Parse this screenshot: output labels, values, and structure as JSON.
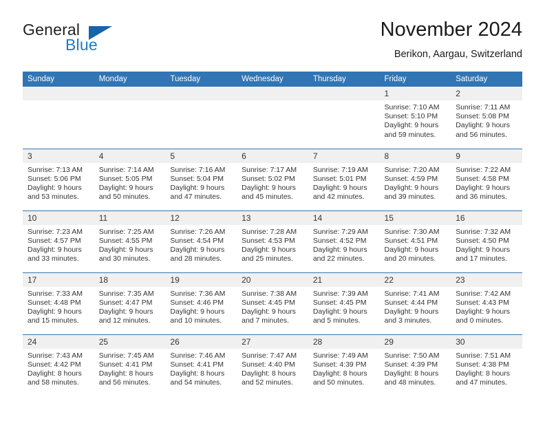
{
  "brand": {
    "name_part1": "General",
    "name_part2": "Blue",
    "flag_icon": "triangle-flag-icon"
  },
  "header": {
    "title": "November 2024",
    "subtitle": "Berikon, Aargau, Switzerland"
  },
  "colors": {
    "header_blue": "#3175b4",
    "daynum_band": "#f0f0f0",
    "brand_blue": "#1a7dc4",
    "text": "#333333"
  },
  "weekday_headers": [
    "Sunday",
    "Monday",
    "Tuesday",
    "Wednesday",
    "Thursday",
    "Friday",
    "Saturday"
  ],
  "weeks": [
    [
      {
        "day": "",
        "empty": true
      },
      {
        "day": "",
        "empty": true
      },
      {
        "day": "",
        "empty": true
      },
      {
        "day": "",
        "empty": true
      },
      {
        "day": "",
        "empty": true
      },
      {
        "day": "1",
        "sunrise": "Sunrise: 7:10 AM",
        "sunset": "Sunset: 5:10 PM",
        "daylight": "Daylight: 9 hours and 59 minutes."
      },
      {
        "day": "2",
        "sunrise": "Sunrise: 7:11 AM",
        "sunset": "Sunset: 5:08 PM",
        "daylight": "Daylight: 9 hours and 56 minutes."
      }
    ],
    [
      {
        "day": "3",
        "sunrise": "Sunrise: 7:13 AM",
        "sunset": "Sunset: 5:06 PM",
        "daylight": "Daylight: 9 hours and 53 minutes."
      },
      {
        "day": "4",
        "sunrise": "Sunrise: 7:14 AM",
        "sunset": "Sunset: 5:05 PM",
        "daylight": "Daylight: 9 hours and 50 minutes."
      },
      {
        "day": "5",
        "sunrise": "Sunrise: 7:16 AM",
        "sunset": "Sunset: 5:04 PM",
        "daylight": "Daylight: 9 hours and 47 minutes."
      },
      {
        "day": "6",
        "sunrise": "Sunrise: 7:17 AM",
        "sunset": "Sunset: 5:02 PM",
        "daylight": "Daylight: 9 hours and 45 minutes."
      },
      {
        "day": "7",
        "sunrise": "Sunrise: 7:19 AM",
        "sunset": "Sunset: 5:01 PM",
        "daylight": "Daylight: 9 hours and 42 minutes."
      },
      {
        "day": "8",
        "sunrise": "Sunrise: 7:20 AM",
        "sunset": "Sunset: 4:59 PM",
        "daylight": "Daylight: 9 hours and 39 minutes."
      },
      {
        "day": "9",
        "sunrise": "Sunrise: 7:22 AM",
        "sunset": "Sunset: 4:58 PM",
        "daylight": "Daylight: 9 hours and 36 minutes."
      }
    ],
    [
      {
        "day": "10",
        "sunrise": "Sunrise: 7:23 AM",
        "sunset": "Sunset: 4:57 PM",
        "daylight": "Daylight: 9 hours and 33 minutes."
      },
      {
        "day": "11",
        "sunrise": "Sunrise: 7:25 AM",
        "sunset": "Sunset: 4:55 PM",
        "daylight": "Daylight: 9 hours and 30 minutes."
      },
      {
        "day": "12",
        "sunrise": "Sunrise: 7:26 AM",
        "sunset": "Sunset: 4:54 PM",
        "daylight": "Daylight: 9 hours and 28 minutes."
      },
      {
        "day": "13",
        "sunrise": "Sunrise: 7:28 AM",
        "sunset": "Sunset: 4:53 PM",
        "daylight": "Daylight: 9 hours and 25 minutes."
      },
      {
        "day": "14",
        "sunrise": "Sunrise: 7:29 AM",
        "sunset": "Sunset: 4:52 PM",
        "daylight": "Daylight: 9 hours and 22 minutes."
      },
      {
        "day": "15",
        "sunrise": "Sunrise: 7:30 AM",
        "sunset": "Sunset: 4:51 PM",
        "daylight": "Daylight: 9 hours and 20 minutes."
      },
      {
        "day": "16",
        "sunrise": "Sunrise: 7:32 AM",
        "sunset": "Sunset: 4:50 PM",
        "daylight": "Daylight: 9 hours and 17 minutes."
      }
    ],
    [
      {
        "day": "17",
        "sunrise": "Sunrise: 7:33 AM",
        "sunset": "Sunset: 4:48 PM",
        "daylight": "Daylight: 9 hours and 15 minutes."
      },
      {
        "day": "18",
        "sunrise": "Sunrise: 7:35 AM",
        "sunset": "Sunset: 4:47 PM",
        "daylight": "Daylight: 9 hours and 12 minutes."
      },
      {
        "day": "19",
        "sunrise": "Sunrise: 7:36 AM",
        "sunset": "Sunset: 4:46 PM",
        "daylight": "Daylight: 9 hours and 10 minutes."
      },
      {
        "day": "20",
        "sunrise": "Sunrise: 7:38 AM",
        "sunset": "Sunset: 4:45 PM",
        "daylight": "Daylight: 9 hours and 7 minutes."
      },
      {
        "day": "21",
        "sunrise": "Sunrise: 7:39 AM",
        "sunset": "Sunset: 4:45 PM",
        "daylight": "Daylight: 9 hours and 5 minutes."
      },
      {
        "day": "22",
        "sunrise": "Sunrise: 7:41 AM",
        "sunset": "Sunset: 4:44 PM",
        "daylight": "Daylight: 9 hours and 3 minutes."
      },
      {
        "day": "23",
        "sunrise": "Sunrise: 7:42 AM",
        "sunset": "Sunset: 4:43 PM",
        "daylight": "Daylight: 9 hours and 0 minutes."
      }
    ],
    [
      {
        "day": "24",
        "sunrise": "Sunrise: 7:43 AM",
        "sunset": "Sunset: 4:42 PM",
        "daylight": "Daylight: 8 hours and 58 minutes."
      },
      {
        "day": "25",
        "sunrise": "Sunrise: 7:45 AM",
        "sunset": "Sunset: 4:41 PM",
        "daylight": "Daylight: 8 hours and 56 minutes."
      },
      {
        "day": "26",
        "sunrise": "Sunrise: 7:46 AM",
        "sunset": "Sunset: 4:41 PM",
        "daylight": "Daylight: 8 hours and 54 minutes."
      },
      {
        "day": "27",
        "sunrise": "Sunrise: 7:47 AM",
        "sunset": "Sunset: 4:40 PM",
        "daylight": "Daylight: 8 hours and 52 minutes."
      },
      {
        "day": "28",
        "sunrise": "Sunrise: 7:49 AM",
        "sunset": "Sunset: 4:39 PM",
        "daylight": "Daylight: 8 hours and 50 minutes."
      },
      {
        "day": "29",
        "sunrise": "Sunrise: 7:50 AM",
        "sunset": "Sunset: 4:39 PM",
        "daylight": "Daylight: 8 hours and 48 minutes."
      },
      {
        "day": "30",
        "sunrise": "Sunrise: 7:51 AM",
        "sunset": "Sunset: 4:38 PM",
        "daylight": "Daylight: 8 hours and 47 minutes."
      }
    ]
  ]
}
